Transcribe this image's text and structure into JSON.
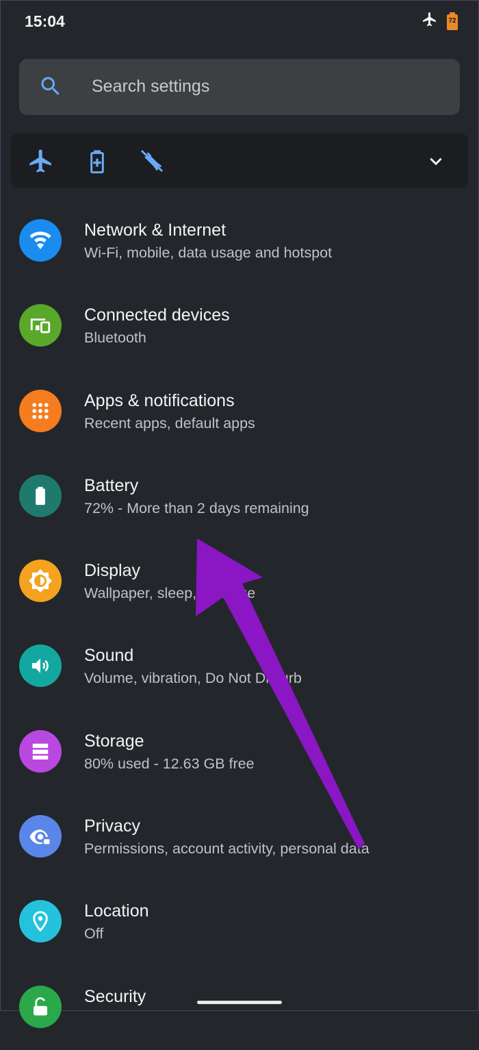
{
  "status_bar": {
    "time": "15:04",
    "battery_level": "72",
    "icons": [
      "airplane-icon",
      "battery-saver-icon"
    ]
  },
  "search": {
    "placeholder": "Search settings"
  },
  "quick_settings": {
    "icons": [
      "airplane-mode-icon",
      "battery-saver-icon",
      "flashlight-off-icon",
      "chevron-down-icon"
    ]
  },
  "settings": {
    "items": [
      {
        "title": "Network & Internet",
        "subtitle": "Wi-Fi, mobile, data usage and hotspot",
        "icon": "wifi-icon",
        "color": "#1a8cf0"
      },
      {
        "title": "Connected devices",
        "subtitle": "Bluetooth",
        "icon": "devices-icon",
        "color": "#59a82a"
      },
      {
        "title": "Apps & notifications",
        "subtitle": "Recent apps, default apps",
        "icon": "apps-grid-icon",
        "color": "#f57c1f"
      },
      {
        "title": "Battery",
        "subtitle": "72% - More than 2 days remaining",
        "icon": "battery-icon",
        "color": "#1f7a6e"
      },
      {
        "title": "Display",
        "subtitle": "Wallpaper, sleep, font size",
        "icon": "brightness-icon",
        "color": "#f5a21f"
      },
      {
        "title": "Sound",
        "subtitle": "Volume, vibration, Do Not Disturb",
        "icon": "volume-icon",
        "color": "#12a8a0"
      },
      {
        "title": "Storage",
        "subtitle": "80% used - 12.63 GB free",
        "icon": "storage-icon",
        "color": "#b948e0"
      },
      {
        "title": "Privacy",
        "subtitle": "Permissions, account activity, personal data",
        "icon": "privacy-eye-icon",
        "color": "#5a86ea"
      },
      {
        "title": "Location",
        "subtitle": "Off",
        "icon": "location-pin-icon",
        "color": "#24c2dc"
      },
      {
        "title": "Security",
        "subtitle": "",
        "icon": "lock-icon",
        "color": "#2aa84a"
      }
    ]
  },
  "colors": {
    "background": "#23272b",
    "search_bg": "#3c4043",
    "quick_bar_bg": "#1b1d20",
    "accent_blue": "#6aa9f5",
    "annotation_arrow": "#8a16c4"
  }
}
